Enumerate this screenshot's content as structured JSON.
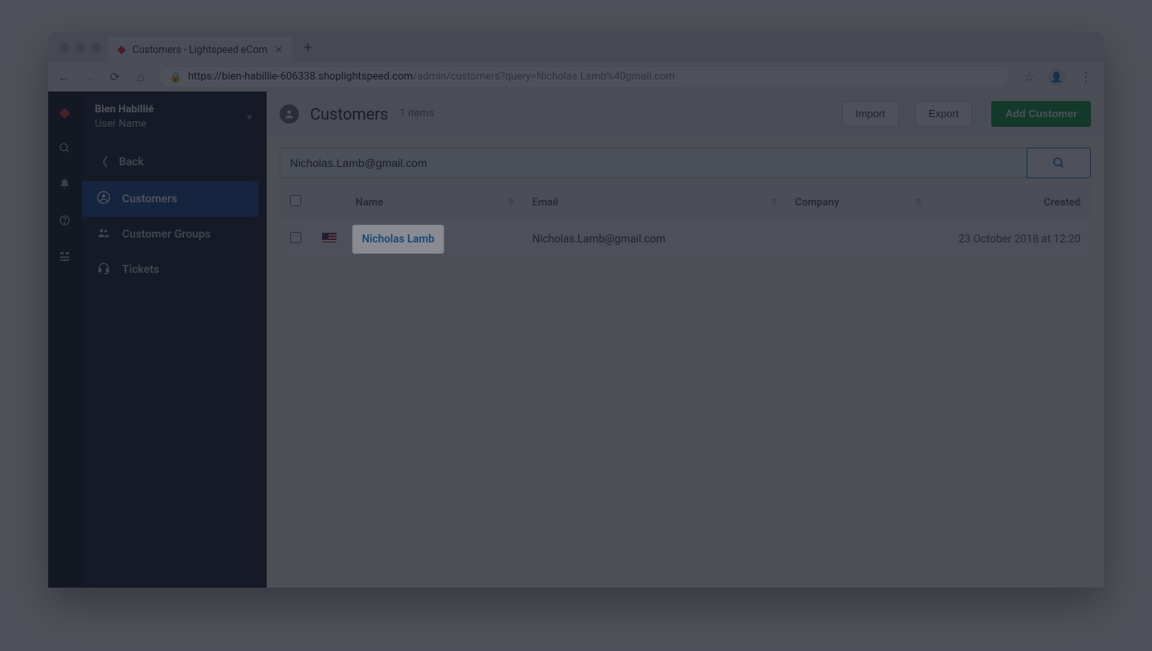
{
  "browser": {
    "tab_title": "Customers - Lightspeed eCom",
    "url_host": "https://bien-habillie-606338.shoplightspeed.com",
    "url_path": "/admin/customers?query=Nicholas.Lamb%40gmail.com"
  },
  "store": {
    "name": "Bien Habillié",
    "user": "User Name"
  },
  "sidebar": {
    "back": "Back",
    "items": [
      {
        "icon": "user-circle-icon",
        "label": "Customers",
        "active": true
      },
      {
        "icon": "users-icon",
        "label": "Customer Groups",
        "active": false
      },
      {
        "icon": "headset-icon",
        "label": "Tickets",
        "active": false
      }
    ]
  },
  "header": {
    "title": "Customers",
    "count": "1 items",
    "import": "Import",
    "export": "Export",
    "add": "Add Customer"
  },
  "search": {
    "value": "Nicholas.Lamb@gmail.com"
  },
  "table": {
    "cols": {
      "name": "Name",
      "email": "Email",
      "company": "Company",
      "created": "Created"
    },
    "rows": [
      {
        "flag": "us",
        "name": "Nicholas Lamb",
        "email": "Nicholas.Lamb@gmail.com",
        "company": "",
        "created": "23 October 2018 at 12:20"
      }
    ]
  }
}
